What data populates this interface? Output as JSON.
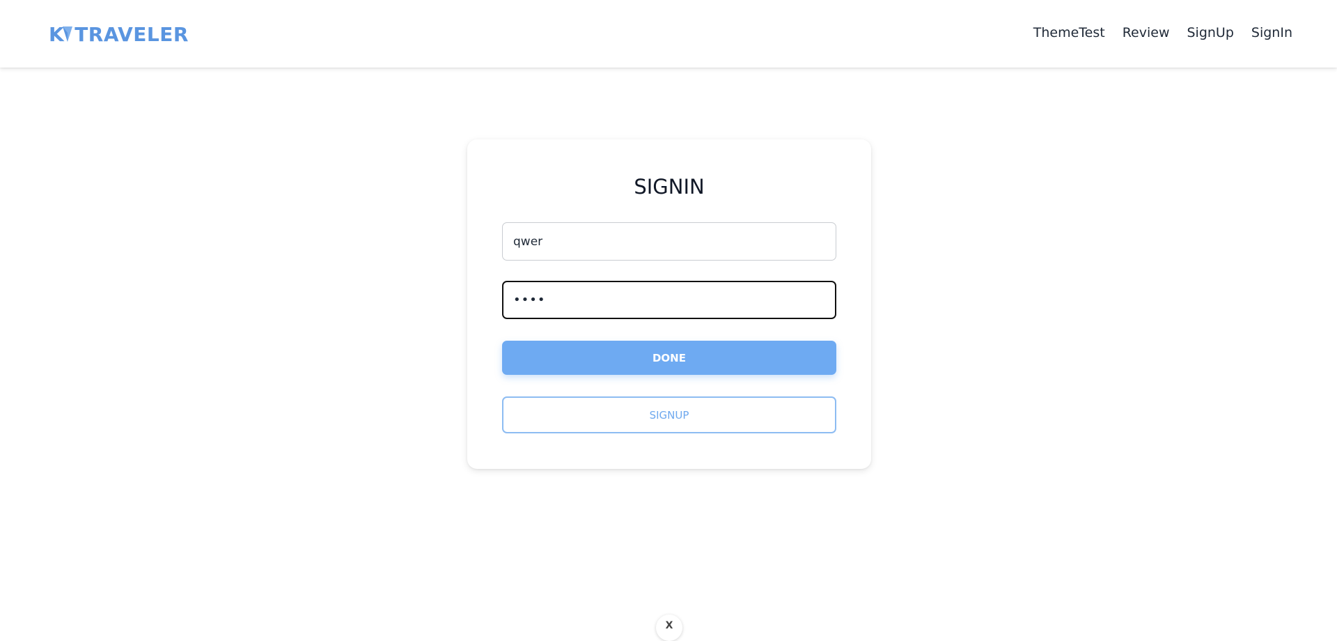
{
  "header": {
    "logo_text_prefix": "K",
    "logo_text_suffix": "TRAVELER",
    "logo_icon": "paper-plane-icon",
    "nav": [
      {
        "label": "ThemeTest"
      },
      {
        "label": "Review"
      },
      {
        "label": "SignUp"
      },
      {
        "label": "SignIn"
      }
    ]
  },
  "signin": {
    "title": "SIGNIN",
    "username_value": "qwer",
    "password_value": "••••",
    "done_label": "DONE",
    "signup_label": "SIGNUP"
  },
  "floating_badge": {
    "icon": "x-icon",
    "label": "X"
  },
  "colors": {
    "brand": "#5a95e0",
    "primary_button": "#6eaaf2",
    "outline_button": "#8dbcf2"
  }
}
